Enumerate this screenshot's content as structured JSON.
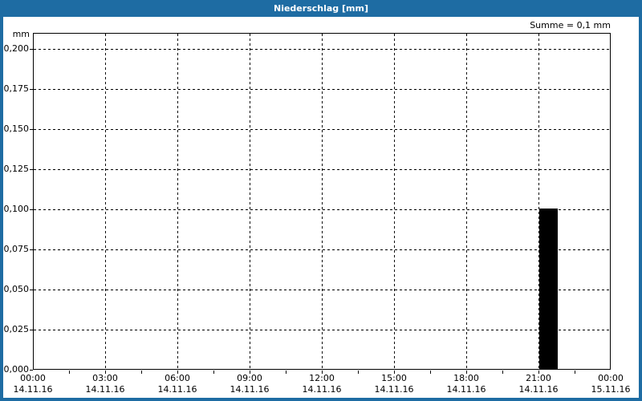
{
  "window": {
    "title": "Niederschlag [mm]"
  },
  "summary": {
    "text": "Summe = 0,1 mm"
  },
  "colors": {
    "titlebar": "#1E6CA3",
    "frame_border": "#1E6CA3",
    "title_text": "#FFFFFF",
    "background": "#FFFFFF",
    "plot_background": "#FFFFFF",
    "axis": "#000000",
    "grid": "#000000",
    "label_text": "#000000",
    "bar": "#000000"
  },
  "chart_data": {
    "type": "bar",
    "title": "Niederschlag [mm]",
    "unit_label": "mm",
    "annotation": "Summe = 0,1 mm",
    "ylim": [
      0,
      0.2
    ],
    "y_tick_step": 0.025,
    "y_tick_labels": [
      "0,000",
      "0,025",
      "0,050",
      "0,075",
      "0,100",
      "0,125",
      "0,150",
      "0,175",
      "0,200"
    ],
    "grid": {
      "style": "dashed",
      "color": "#000000"
    },
    "legend": "none",
    "x_axis": {
      "start_hour": 0,
      "end_hour": 24,
      "major_tick_hours": [
        0,
        3,
        6,
        9,
        12,
        15,
        18,
        21,
        24
      ],
      "minor_tick_step_hours": 1.5,
      "labels": [
        {
          "time": "00:00",
          "date": "14.11.16"
        },
        {
          "time": "03:00",
          "date": "14.11.16"
        },
        {
          "time": "06:00",
          "date": "14.11.16"
        },
        {
          "time": "09:00",
          "date": "14.11.16"
        },
        {
          "time": "12:00",
          "date": "14.11.16"
        },
        {
          "time": "15:00",
          "date": "14.11.16"
        },
        {
          "time": "18:00",
          "date": "14.11.16"
        },
        {
          "time": "21:00",
          "date": "14.11.16"
        },
        {
          "time": "00:00",
          "date": "15.11.16"
        }
      ]
    },
    "bars": [
      {
        "start_hour": 21.0,
        "duration_hours": 0.75,
        "value": 0.1,
        "time": "21:00",
        "date": "14.11.16"
      }
    ]
  }
}
